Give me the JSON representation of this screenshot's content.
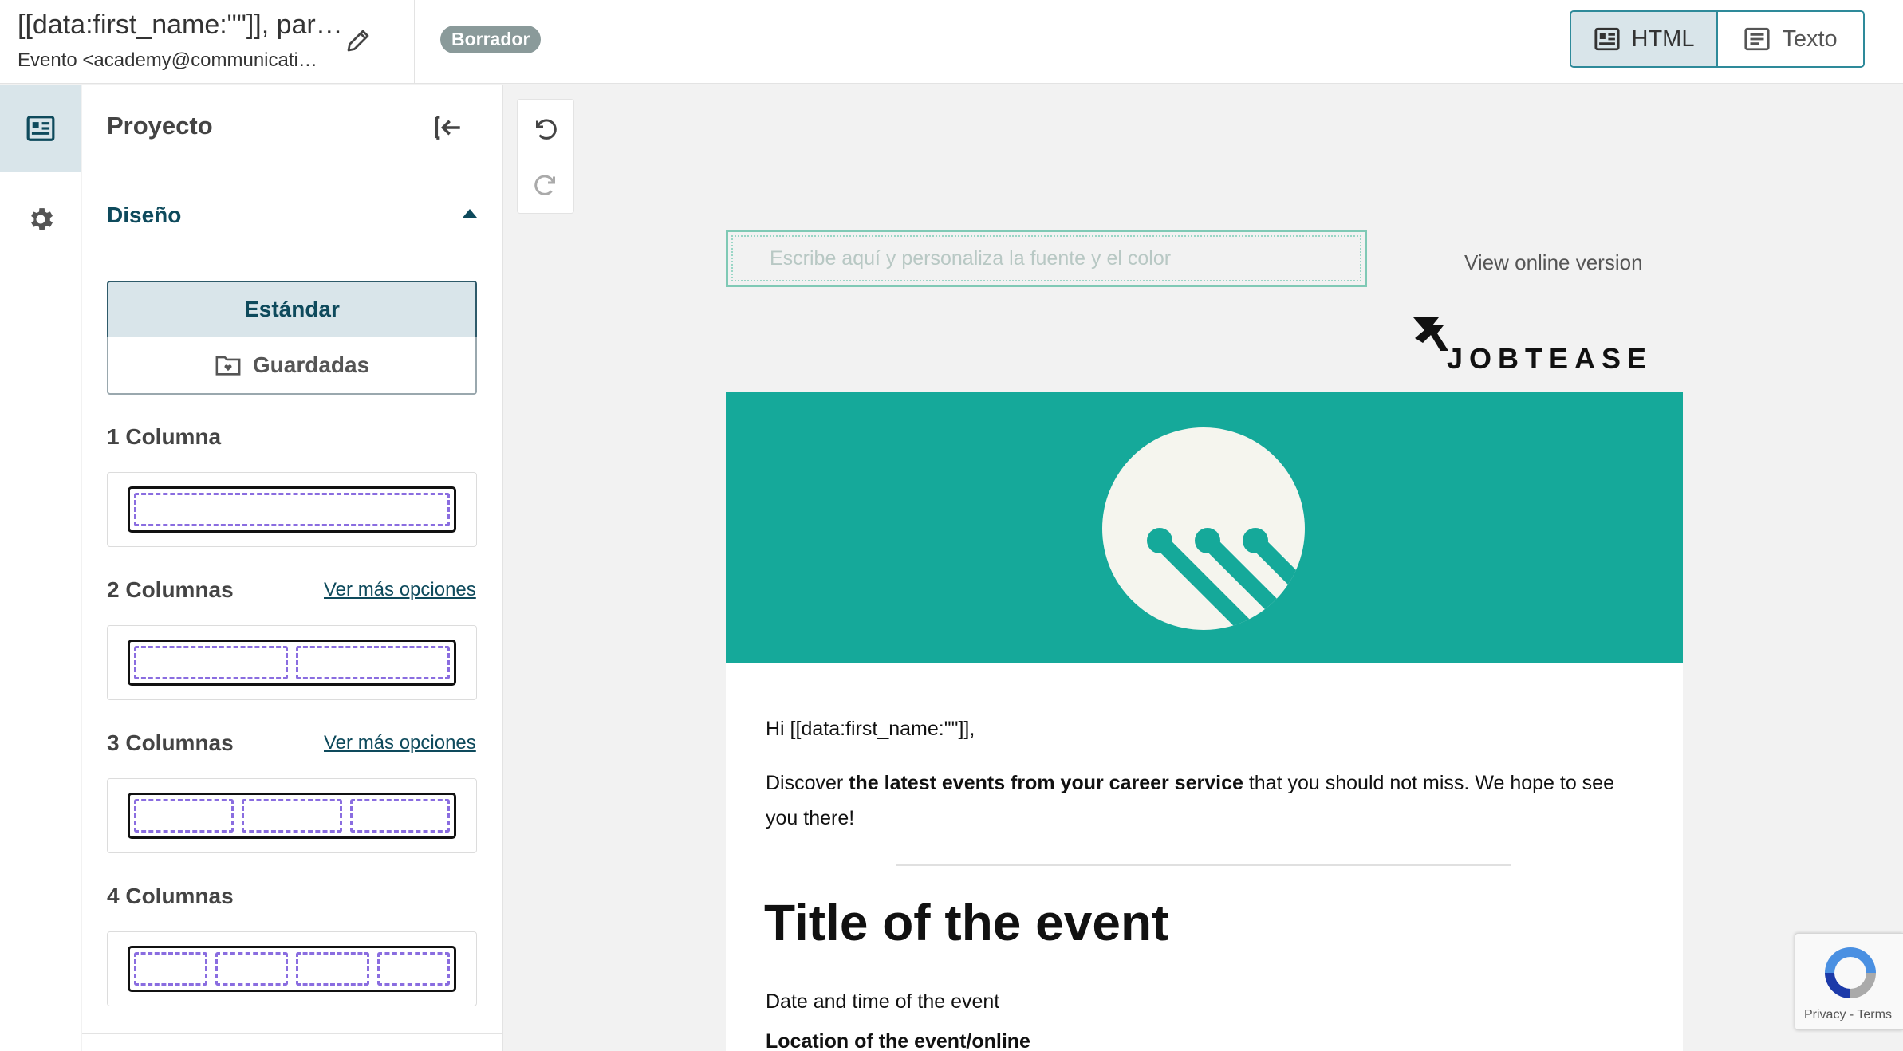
{
  "header": {
    "title": "[[data:first_name:\"\"]], par…",
    "sender": "Evento <academy@communicati…",
    "status_badge": "Borrador",
    "view_html_label": "HTML",
    "view_text_label": "Texto"
  },
  "panel": {
    "title": "Proyecto",
    "design_label": "Diseño",
    "tabs": {
      "standard": "Estándar",
      "saved": "Guardadas"
    },
    "sections": [
      {
        "label": "1 Columna",
        "more": "",
        "columns": 1
      },
      {
        "label": "2 Columnas",
        "more": "Ver más opciones",
        "columns": 2
      },
      {
        "label": "3 Columnas",
        "more": "Ver más opciones",
        "columns": 3
      },
      {
        "label": "4 Columnas",
        "more": "",
        "columns": 4
      }
    ]
  },
  "email": {
    "preheader_placeholder": "Escribe aquí y personaliza la fuente y el color",
    "view_online": "View online version",
    "brand_name": "JOBTEASER",
    "greeting": "Hi [[data:first_name:\"\"]],",
    "intro_pre": "Discover ",
    "intro_bold": "the latest events from your career service",
    "intro_post": " that you should not miss. We hope to see you there!",
    "event_title": "Title of the event",
    "event_date": "Date and time of the event",
    "event_location": "Location of the event/online"
  },
  "recaptcha": {
    "text": "Privacy - Terms"
  },
  "colors": {
    "accent": "#2e8a9a",
    "hero": "#15a99a",
    "selection": "#d9e5ea",
    "layout_slot": "#8a6de0"
  }
}
